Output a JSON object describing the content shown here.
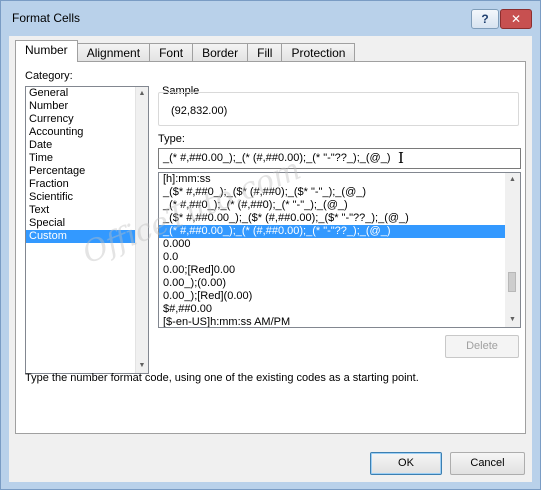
{
  "window": {
    "title": "Format Cells",
    "help_glyph": "?",
    "close_glyph": "✕"
  },
  "tabs": [
    {
      "label": "Number",
      "active": true
    },
    {
      "label": "Alignment"
    },
    {
      "label": "Font"
    },
    {
      "label": "Border"
    },
    {
      "label": "Fill"
    },
    {
      "label": "Protection"
    }
  ],
  "category": {
    "label": "Category:",
    "items": [
      "General",
      "Number",
      "Currency",
      "Accounting",
      "Date",
      "Time",
      "Percentage",
      "Fraction",
      "Scientific",
      "Text",
      "Special",
      "Custom"
    ],
    "selected": "Custom"
  },
  "sample": {
    "label": "Sample",
    "value": "(92,832.00)"
  },
  "type": {
    "label": "Type:",
    "value": "_(* #,##0.00_);_(* (#,##0.00);_(* \"-\"??_);_(@_)"
  },
  "formats": [
    "[h]:mm:ss",
    "_($* #,##0_);_($* (#,##0);_($* \"-\"_);_(@_)",
    "_(* #,##0_);_(* (#,##0);_(* \"-\"_);_(@_)",
    "_($* #,##0.00_);_($* (#,##0.00);_($* \"-\"??_);_(@_)",
    "_(* #,##0.00_);_(* (#,##0.00);_(* \"-\"??_);_(@_)",
    "0.000",
    "0.0",
    "0.00;[Red]0.00",
    "0.00_);(0.00)",
    "0.00_);[Red](0.00)",
    "$#,##0.00",
    "[$-en-US]h:mm:ss AM/PM"
  ],
  "selected_format_index": 4,
  "buttons": {
    "delete": "Delete",
    "ok": "OK",
    "cancel": "Cancel"
  },
  "description": "Type the number format code, using one of the existing codes as a starting point.",
  "watermark": "OfficeTuto.com",
  "icons": {
    "scroll_up": "▲",
    "scroll_down": "▼"
  }
}
